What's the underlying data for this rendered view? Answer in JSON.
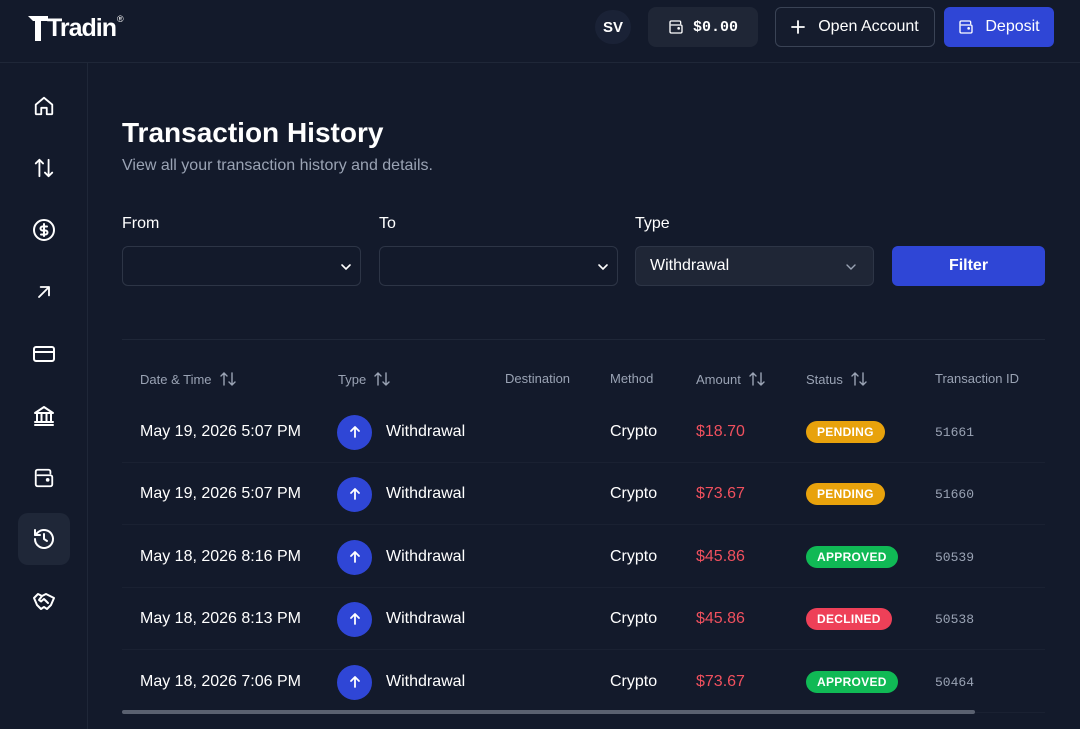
{
  "brand": {
    "name": "Tradin",
    "reg": "®"
  },
  "header": {
    "avatar_initials": "SV",
    "balance": "$0.00",
    "open_account_label": "Open Account",
    "deposit_label": "Deposit"
  },
  "sidebar": {
    "items": [
      {
        "icon": "home-icon"
      },
      {
        "icon": "transfer-icon"
      },
      {
        "icon": "dollar-icon"
      },
      {
        "icon": "arrow-up-right-icon"
      },
      {
        "icon": "card-icon"
      },
      {
        "icon": "bank-icon"
      },
      {
        "icon": "wallet-icon"
      },
      {
        "icon": "history-icon",
        "active": true
      },
      {
        "icon": "handshake-icon"
      }
    ]
  },
  "page": {
    "title": "Transaction History",
    "subtitle": "View all your transaction history and details."
  },
  "filters": {
    "from_label": "From",
    "from_value": "",
    "to_label": "To",
    "to_value": "",
    "type_label": "Type",
    "type_value": "Withdrawal",
    "filter_label": "Filter"
  },
  "table": {
    "headers": {
      "datetime": "Date & Time",
      "type": "Type",
      "destination": "Destination",
      "method": "Method",
      "amount": "Amount",
      "status": "Status",
      "txid": "Transaction ID"
    },
    "rows": [
      {
        "datetime": "May 19, 2026 5:07 PM",
        "type": "Withdrawal",
        "destination": "",
        "method": "Crypto",
        "amount": "$18.70",
        "status": "PENDING",
        "status_kind": "pending",
        "txid": "51661"
      },
      {
        "datetime": "May 19, 2026 5:07 PM",
        "type": "Withdrawal",
        "destination": "",
        "method": "Crypto",
        "amount": "$73.67",
        "status": "PENDING",
        "status_kind": "pending",
        "txid": "51660"
      },
      {
        "datetime": "May 18, 2026 8:16 PM",
        "type": "Withdrawal",
        "destination": "",
        "method": "Crypto",
        "amount": "$45.86",
        "status": "APPROVED",
        "status_kind": "approved",
        "txid": "50539"
      },
      {
        "datetime": "May 18, 2026 8:13 PM",
        "type": "Withdrawal",
        "destination": "",
        "method": "Crypto",
        "amount": "$45.86",
        "status": "DECLINED",
        "status_kind": "declined",
        "txid": "50538"
      },
      {
        "datetime": "May 18, 2026 7:06 PM",
        "type": "Withdrawal",
        "destination": "",
        "method": "Crypto",
        "amount": "$73.67",
        "status": "APPROVED",
        "status_kind": "approved",
        "txid": "50464"
      }
    ]
  },
  "colors": {
    "accent": "#2f46d6",
    "pending": "#e8a20c",
    "approved": "#10b955",
    "declined": "#ee4058",
    "amount": "#f0505e"
  }
}
